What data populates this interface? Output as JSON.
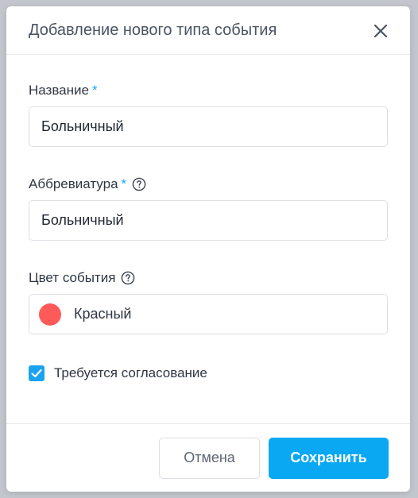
{
  "dialog": {
    "title": "Добавление нового типа события"
  },
  "fields": {
    "name": {
      "label": "Название",
      "required_mark": "*",
      "value": "Больничный"
    },
    "abbreviation": {
      "label": "Аббревиатура",
      "required_mark": "*",
      "value": "Больничный"
    },
    "color": {
      "label": "Цвет события",
      "selected_label": "Красный",
      "selected_hex": "#ff5a5a"
    },
    "approval": {
      "label": "Требуется согласование",
      "checked": true
    }
  },
  "footer": {
    "cancel_label": "Отмена",
    "save_label": "Сохранить"
  },
  "theme": {
    "accent": "#0aa8f2",
    "required": "#19a8f0"
  }
}
